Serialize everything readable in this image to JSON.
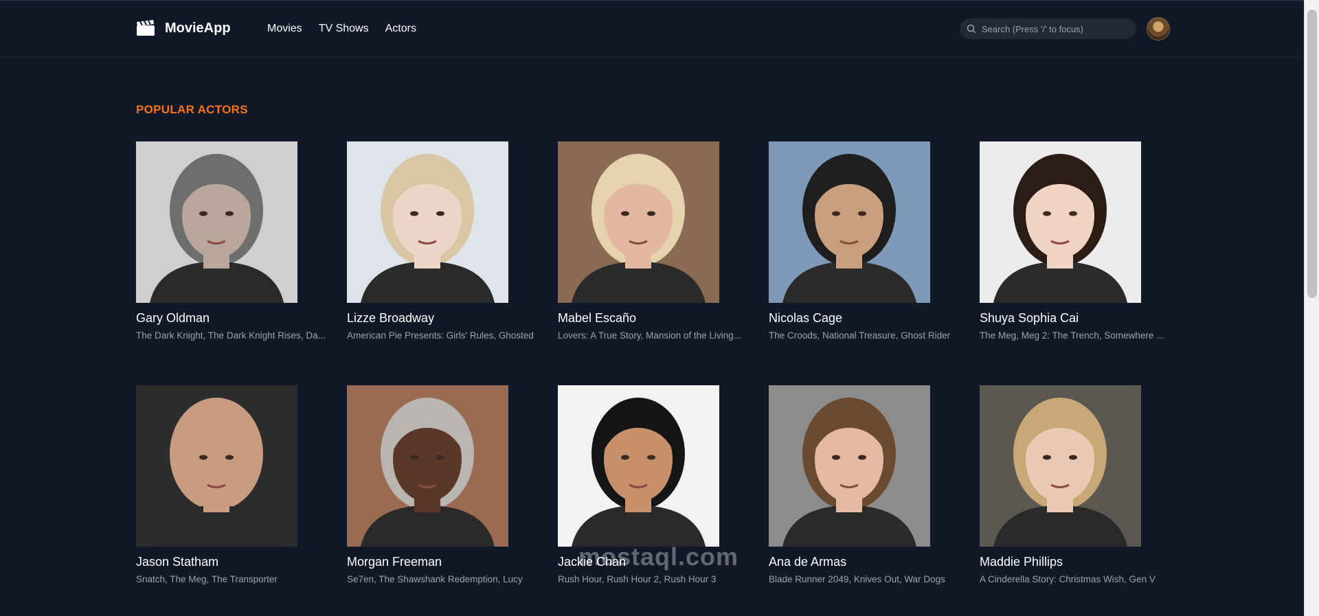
{
  "app": {
    "name": "MovieApp",
    "logo_icon": "film-clapper-icon"
  },
  "nav": {
    "items": [
      {
        "label": "Movies"
      },
      {
        "label": "TV Shows"
      },
      {
        "label": "Actors"
      }
    ]
  },
  "search": {
    "placeholder": "Search (Press '/' to focus)",
    "icon": "search-icon"
  },
  "user": {
    "avatar_icon": "user-avatar"
  },
  "colors": {
    "background": "#111827",
    "accent": "#f97316",
    "muted_text": "#9ca3af",
    "search_bg": "#1f2937"
  },
  "section": {
    "title": "POPULAR ACTORS"
  },
  "actors": [
    {
      "name": "Gary Oldman",
      "known_for": "The Dark Knight, The Dark Knight Rises, Da...",
      "bg": "#cfcfcf",
      "skin": "#b8a79a",
      "hair": "#6e6e6e"
    },
    {
      "name": "Lizze Broadway",
      "known_for": "American Pie Presents: Girls' Rules, Ghosted",
      "bg": "#dfe4ea",
      "skin": "#edd6c8",
      "hair": "#d8c6a4"
    },
    {
      "name": "Mabel Escaño",
      "known_for": "Lovers: A True Story, Mansion of the Living...",
      "bg": "#8a6a52",
      "skin": "#e2b9a0",
      "hair": "#e6d3ad"
    },
    {
      "name": "Nicolas Cage",
      "known_for": "The Croods, National Treasure, Ghost Rider",
      "bg": "#7f9ab8",
      "skin": "#c9a07f",
      "hair": "#1e1e1e"
    },
    {
      "name": "Shuya Sophia Cai",
      "known_for": "The Meg, Meg 2: The Trench, Somewhere ...",
      "bg": "#ececec",
      "skin": "#f1d4c3",
      "hair": "#2b1d16"
    },
    {
      "name": "Jason Statham",
      "known_for": "Snatch, The Meg, The Transporter",
      "bg": "#2c2c2c",
      "skin": "#c99b7f",
      "hair": "#c99b7f"
    },
    {
      "name": "Morgan Freeman",
      "known_for": "Se7en, The Shawshank Redemption, Lucy",
      "bg": "#9b6a52",
      "skin": "#5a3726",
      "hair": "#b9b6b2"
    },
    {
      "name": "Jackie Chan",
      "known_for": "Rush Hour, Rush Hour 2, Rush Hour 3",
      "bg": "#f2f2f2",
      "skin": "#c88f6b",
      "hair": "#151515"
    },
    {
      "name": "Ana de Armas",
      "known_for": "Blade Runner 2049, Knives Out, War Dogs",
      "bg": "#8c8c8c",
      "skin": "#e3b9a1",
      "hair": "#6b4a2f"
    },
    {
      "name": "Maddie Phillips",
      "known_for": "A Cinderella Story: Christmas Wish, Gen V",
      "bg": "#5b5751",
      "skin": "#ecc9b4",
      "hair": "#c9a877"
    }
  ],
  "watermark": {
    "text": "mostaql.com"
  }
}
